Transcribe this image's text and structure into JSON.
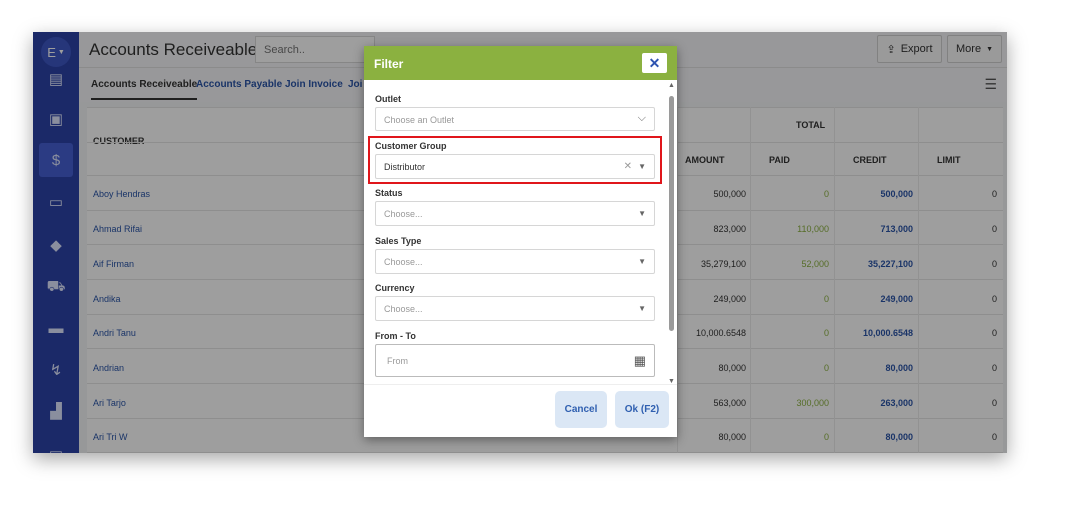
{
  "app": {
    "title": "Accounts Receiveable",
    "avatar_letter": "E",
    "search_placeholder": "Search..",
    "export_label": "Export",
    "more_label": "More"
  },
  "tabs": [
    "Accounts Receiveable",
    "Accounts Payable",
    "Join Invoice",
    "Joi"
  ],
  "table": {
    "customer_header": "CUSTOMER",
    "total_header": "TOTAL",
    "columns": [
      "AMOUNT",
      "PAID",
      "CREDIT",
      "LIMIT"
    ],
    "rows": [
      {
        "customer": "Aboy Hendras",
        "amount": "500,000",
        "paid": "0",
        "credit": "500,000",
        "limit": "0"
      },
      {
        "customer": "Ahmad Rifai",
        "amount": "823,000",
        "paid": "110,000",
        "credit": "713,000",
        "limit": "0"
      },
      {
        "customer": "Aif Firman",
        "amount": "35,279,100",
        "paid": "52,000",
        "credit": "35,227,100",
        "limit": "0"
      },
      {
        "customer": "Andika",
        "amount": "249,000",
        "paid": "0",
        "credit": "249,000",
        "limit": "0"
      },
      {
        "customer": "Andri Tanu",
        "amount": "10,000.6548",
        "paid": "0",
        "credit": "10,000.6548",
        "limit": "0"
      },
      {
        "customer": "Andrian",
        "amount": "80,000",
        "paid": "0",
        "credit": "80,000",
        "limit": "0"
      },
      {
        "customer": "Ari Tarjo",
        "amount": "563,000",
        "paid": "300,000",
        "credit": "263,000",
        "limit": "0"
      },
      {
        "customer": "Ari Tri W",
        "amount": "80,000",
        "paid": "0",
        "credit": "80,000",
        "limit": "0"
      }
    ]
  },
  "filter": {
    "title": "Filter",
    "outlet_label": "Outlet",
    "outlet_placeholder": "Choose an Outlet",
    "customer_group_label": "Customer Group",
    "customer_group_value": "Distributor",
    "status_label": "Status",
    "status_placeholder": "Choose...",
    "sales_type_label": "Sales Type",
    "sales_type_placeholder": "Choose...",
    "currency_label": "Currency",
    "currency_placeholder": "Choose...",
    "from_to_label": "From - To",
    "from_placeholder": "From",
    "cancel_label": "Cancel",
    "ok_label": "Ok (F2)"
  },
  "colors": {
    "sidebar": "#2d43a8",
    "modal_header": "#8bb140",
    "highlight": "#e0161b",
    "link": "#2a55a8",
    "paid_green": "#8bb140"
  }
}
